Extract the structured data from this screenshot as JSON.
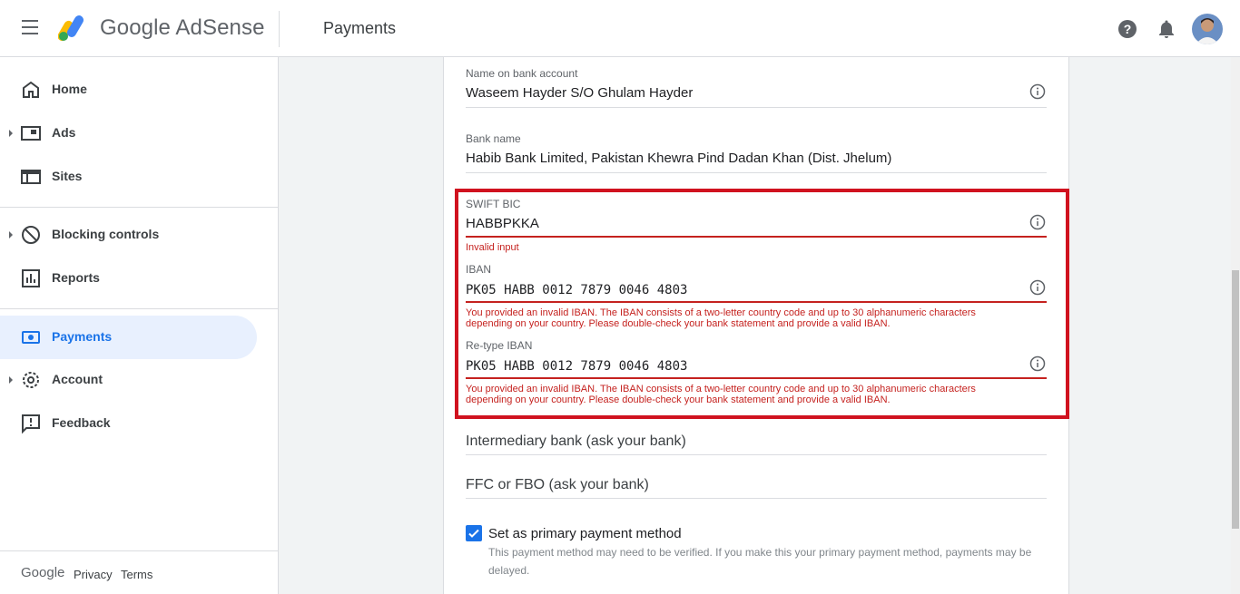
{
  "header": {
    "brand": "Google AdSense",
    "page_title": "Payments"
  },
  "sidebar": {
    "items": [
      {
        "label": "Home",
        "icon": "home-icon"
      },
      {
        "label": "Ads",
        "icon": "ads-icon"
      },
      {
        "label": "Sites",
        "icon": "sites-icon"
      },
      {
        "label": "Blocking controls",
        "icon": "block-icon"
      },
      {
        "label": "Reports",
        "icon": "reports-icon"
      },
      {
        "label": "Payments",
        "icon": "payments-icon",
        "active": true
      },
      {
        "label": "Account",
        "icon": "gear-icon"
      },
      {
        "label": "Feedback",
        "icon": "feedback-icon"
      }
    ],
    "footer": {
      "google": "Google",
      "privacy": "Privacy",
      "terms": "Terms"
    }
  },
  "form": {
    "name_on_account": {
      "label": "Name on bank account",
      "value": "Waseem Hayder S/O Ghulam Hayder"
    },
    "bank_name": {
      "label": "Bank name",
      "value": "Habib Bank Limited, Pakistan Khewra Pind Dadan Khan (Dist. Jhelum)"
    },
    "swift": {
      "label": "SWIFT BIC",
      "value": "HABBPKKA",
      "error": "Invalid input"
    },
    "iban": {
      "label": "IBAN",
      "value": "PK05 HABB 0012 7879 0046 4803",
      "error_line1": "You provided an invalid IBAN. The IBAN consists of a two-letter country code and up to 30 alphanumeric characters",
      "error_line2": "depending on your country. Please double-check your bank statement and provide a valid IBAN."
    },
    "retype_iban": {
      "label": "Re-type IBAN",
      "value": "PK05 HABB 0012 7879 0046 4803",
      "error_line1": "You provided an invalid IBAN. The IBAN consists of a two-letter country code and up to 30 alphanumeric characters",
      "error_line2": "depending on your country. Please double-check your bank statement and provide a valid IBAN."
    },
    "intermediary": {
      "placeholder": "Intermediary bank (ask your bank)"
    },
    "ffc": {
      "placeholder": "FFC or FBO (ask your bank)"
    },
    "primary": {
      "checked": true,
      "label": "Set as primary payment method",
      "description": "This payment method may need to be verified. If you make this your primary payment method, payments may be delayed."
    }
  },
  "colors": {
    "accent": "#1a73e8",
    "error": "#c5221f",
    "highlight": "#d0121f"
  }
}
